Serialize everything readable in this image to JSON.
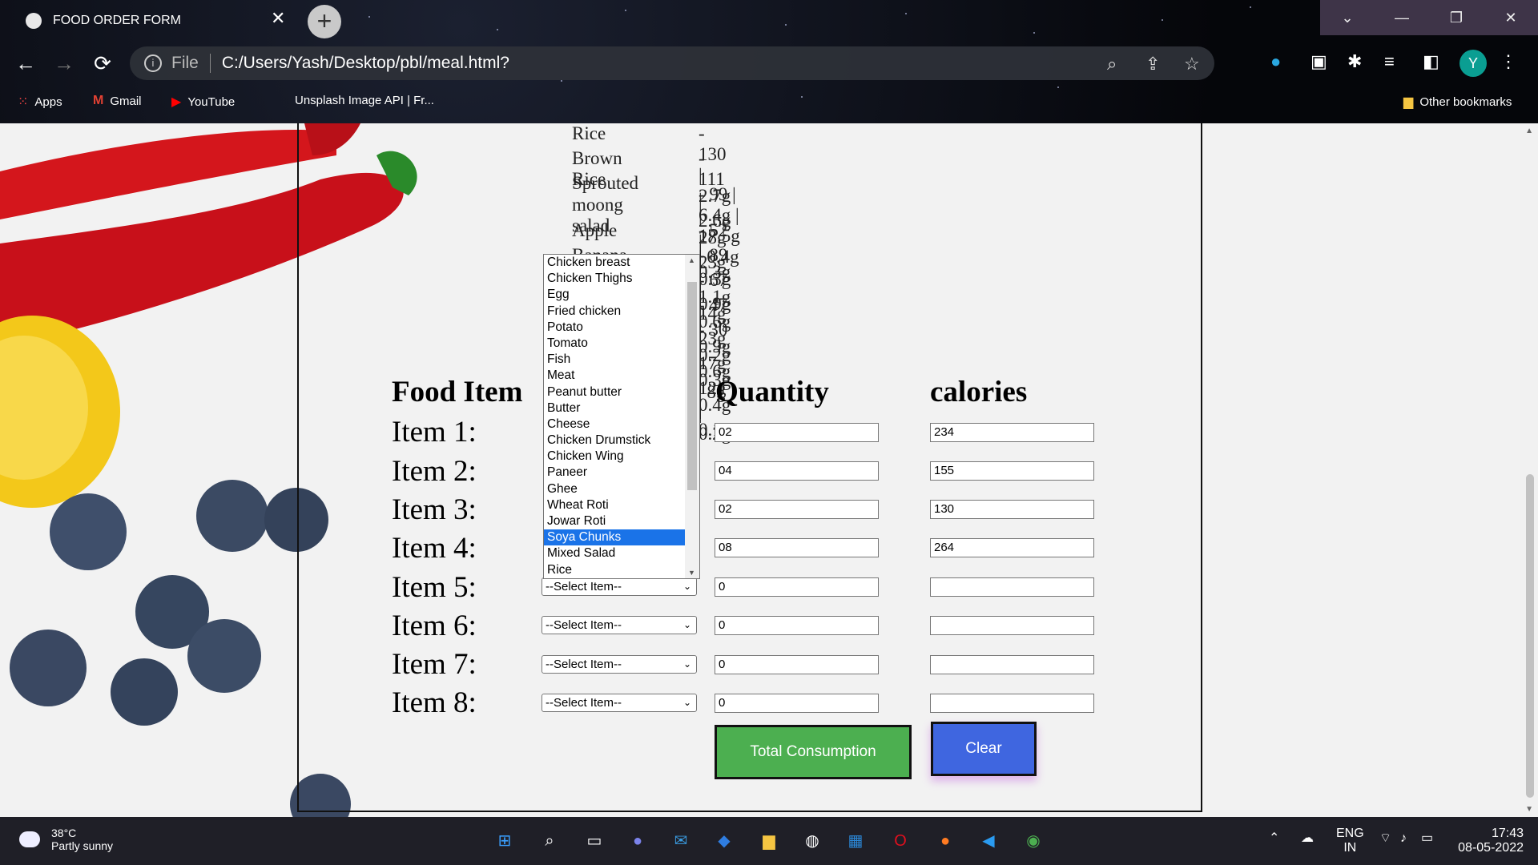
{
  "browser": {
    "tab_title": "FOOD ORDER FORM",
    "tab_close": "✕",
    "new_tab": "+",
    "url_scheme": "File",
    "url": "C:/Users/Yash/Desktop/pbl/meal.html?",
    "profile_initial": "Y",
    "bookmarks": [
      "Apps",
      "Gmail",
      "YouTube",
      "Unsplash Image API | Fr..."
    ],
    "other_bookmarks": "Other bookmarks"
  },
  "nutrition": [
    {
      "name": "Rice",
      "values": "- 130 | 2.7g | 28g | 0.3g"
    },
    {
      "name": "Brown Rice",
      "values": "- 111 | 2.6g | 23g | 0.9g"
    },
    {
      "name": "Sprouted",
      "name2": "moong salad",
      "values": "- 99 | 6.4g | 17.5g | 0.4g"
    },
    {
      "name": "Apple",
      "values": "- 52 | 0.3g | 14g | 0.2g"
    },
    {
      "name": "Banana",
      "values": "- 89 | 1.1g | 23g | 0.3g"
    },
    {
      "name": "",
      "values": "- 67 | 0.6g | 17g | 0.4g"
    },
    {
      "name": "",
      "values": "- 47 | 0.9g | 12g | 0.1g"
    },
    {
      "name": "",
      "values": "- 30 | 0.6g | 8g | 0.2g"
    }
  ],
  "form": {
    "headers": {
      "food_item": "Food Item",
      "quantity": "Quantity",
      "calories": "calories"
    },
    "select_placeholder": "--Select Item--",
    "items": [
      {
        "label": "Item 1:",
        "quantity": "02",
        "calories": "234"
      },
      {
        "label": "Item 2:",
        "quantity": "04",
        "calories": "155"
      },
      {
        "label": "Item 3:",
        "quantity": "02",
        "calories": "130"
      },
      {
        "label": "Item 4:",
        "quantity": "08",
        "calories": "264"
      },
      {
        "label": "Item 5:",
        "quantity": "0",
        "calories": ""
      },
      {
        "label": "Item 6:",
        "quantity": "0",
        "calories": ""
      },
      {
        "label": "Item 7:",
        "quantity": "0",
        "calories": ""
      },
      {
        "label": "Item 8:",
        "quantity": "0",
        "calories": ""
      }
    ],
    "dropdown_options": [
      "Chicken breast",
      "Chicken Thighs",
      "Egg",
      "Fried chicken",
      "Potato",
      "Tomato",
      "Fish",
      "Meat",
      "Peanut butter",
      "Butter",
      "Cheese",
      "Chicken Drumstick",
      "Chicken Wing",
      "Paneer",
      "Ghee",
      "Wheat Roti",
      "Jowar Roti",
      "Soya Chunks",
      "Mixed Salad",
      "Rice"
    ],
    "dropdown_selected": "Soya Chunks",
    "total_button": "Total Consumption",
    "clear_button": "Clear"
  },
  "colors": {
    "total_button": "#4caf50",
    "clear_button": "#3f66e0",
    "selected_option": "#1a73e8"
  },
  "taskbar": {
    "temperature": "38°C",
    "weather": "Partly sunny",
    "language": "ENG",
    "region": "IN",
    "time": "17:43",
    "date": "08-05-2022"
  }
}
